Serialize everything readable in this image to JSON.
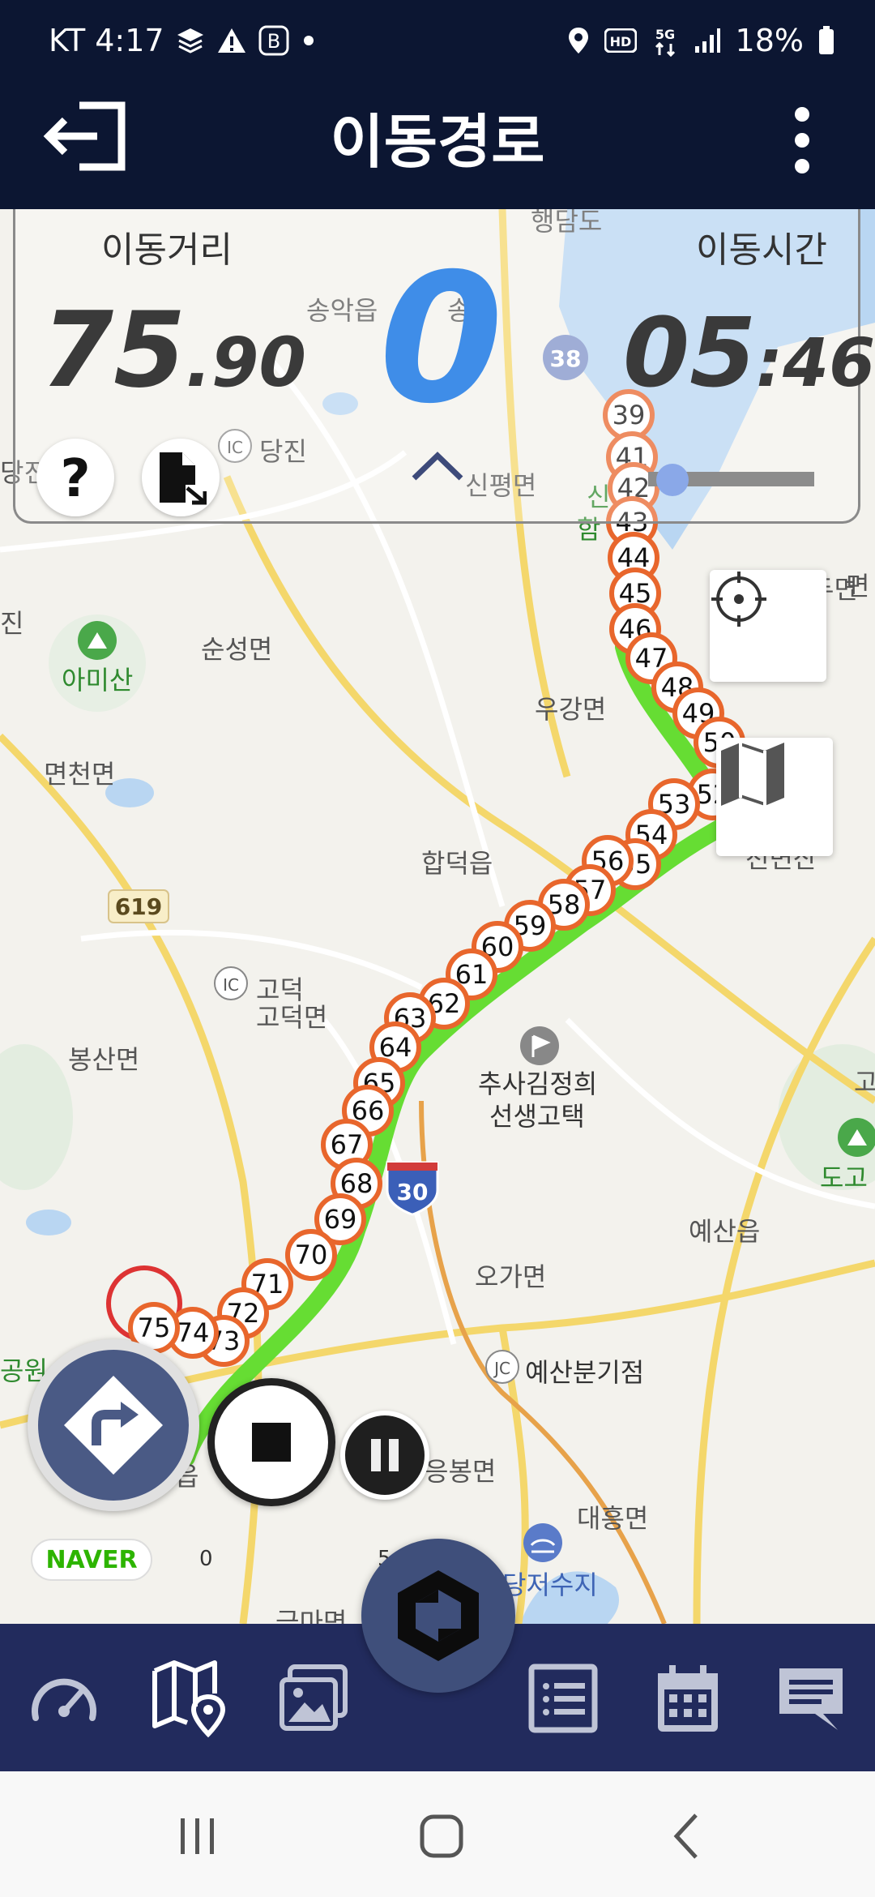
{
  "status_bar": {
    "carrier_time": "KT 4:17",
    "battery": "18%",
    "icons": [
      "layers-icon",
      "warning-icon",
      "b-icon",
      "dot-icon",
      "location-icon",
      "hd-icon",
      "5g-icon",
      "signal-icon",
      "battery-icon"
    ]
  },
  "header": {
    "title": "이동경로",
    "back_icon": "exit-icon",
    "menu_icon": "more-vertical-icon"
  },
  "info_panel": {
    "distance_label": "이동거리",
    "distance_int": "75",
    "distance_dec": ".90",
    "speed": "0",
    "time_label": "이동시간",
    "time_main": "05",
    "time_sec": ":46",
    "help_icon": "help-icon",
    "file_icon": "file-export-icon",
    "collapse_icon": "chevron-up-icon"
  },
  "map": {
    "places": [
      "행담도",
      "송악읍",
      "송악",
      "당진",
      "신평면",
      "신",
      "함",
      "면",
      "당진",
      "진",
      "아미산",
      "순성면",
      "면천면",
      "우강면",
      "합덕읍",
      "고덕",
      "고덕면",
      "봉산면",
      "추사김정희",
      "선생고택",
      "오가면",
      "예산읍",
      "도고",
      "예산분기점",
      "응봉면",
      "대흥면",
      "당저수지",
      "공원",
      "읍",
      "고",
      "천변산",
      "두면",
      "금마면"
    ],
    "road_badges": [
      "38",
      "619",
      "30",
      "IC",
      "IC",
      "JC"
    ],
    "markers": [
      "39",
      "41",
      "42",
      "43",
      "44",
      "45",
      "46",
      "47",
      "48",
      "49",
      "50",
      "52",
      "53",
      "54",
      "55",
      "56",
      "57",
      "58",
      "59",
      "60",
      "61",
      "62",
      "63",
      "64",
      "65",
      "66",
      "67",
      "68",
      "69",
      "70",
      "71",
      "72",
      "73",
      "74",
      "75"
    ],
    "locate_icon": "crosshair-icon",
    "map_type_icon": "map-icon",
    "naver_logo": "NAVER",
    "scale_start": "0",
    "scale_end": "5"
  },
  "controls": {
    "navigate_icon": "turn-right-icon",
    "stop_icon": "stop-icon",
    "pause_icon": "pause-icon"
  },
  "tabbar": {
    "tabs": [
      "speedometer-icon",
      "map-pin-icon",
      "gallery-icon",
      "app-logo-icon",
      "list-icon",
      "calendar-icon",
      "message-icon"
    ]
  },
  "system_nav": {
    "keys": [
      "recent-apps-icon",
      "home-icon",
      "back-icon"
    ]
  },
  "colors": {
    "header_bg": "#0c1632",
    "tab_bg": "#222b5d",
    "route_marker": "#e8662c",
    "route_line": "#66dd33",
    "speed": "#3f8de8"
  }
}
